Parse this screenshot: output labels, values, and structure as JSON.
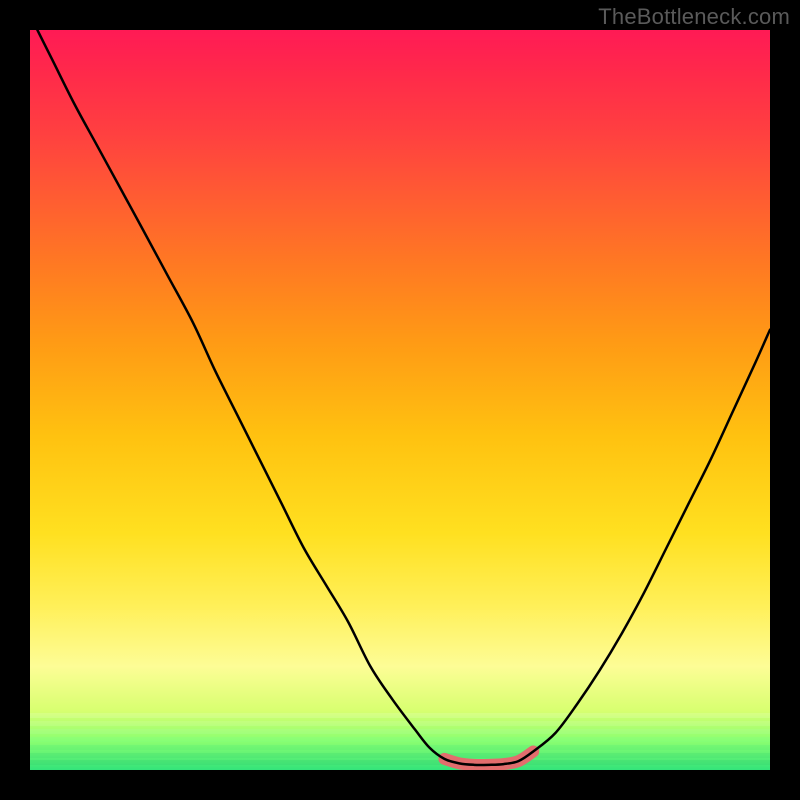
{
  "watermark": "TheBottleneck.com",
  "colors": {
    "background": "#000000",
    "curve_stroke": "#000000",
    "highlight": "#e26d6d",
    "gradient_top": "#ff1a55",
    "gradient_bottom": "#33e47a"
  },
  "chart_data": {
    "type": "line",
    "title": "",
    "xlabel": "",
    "ylabel": "",
    "xlim": [
      0,
      100
    ],
    "ylim": [
      0,
      100
    ],
    "x": [
      0,
      3,
      6,
      9,
      12,
      15,
      18.5,
      22,
      25,
      28,
      31,
      34,
      37,
      40,
      43,
      46,
      49,
      52,
      54,
      56,
      58,
      60,
      62,
      64,
      66,
      68,
      71,
      74,
      77,
      80,
      83,
      86,
      89,
      92,
      95,
      98,
      100
    ],
    "y": [
      102,
      96,
      90,
      84.5,
      79,
      73.5,
      67,
      60.5,
      54,
      48,
      42,
      36,
      30,
      25,
      20,
      14,
      9.5,
      5.5,
      3,
      1.5,
      0.9,
      0.7,
      0.7,
      0.8,
      1.2,
      2.5,
      5,
      9,
      13.5,
      18.5,
      24,
      30,
      36,
      42,
      48.5,
      55,
      59.5
    ],
    "highlight_region": {
      "x_start": 56,
      "x_end": 68
    }
  }
}
